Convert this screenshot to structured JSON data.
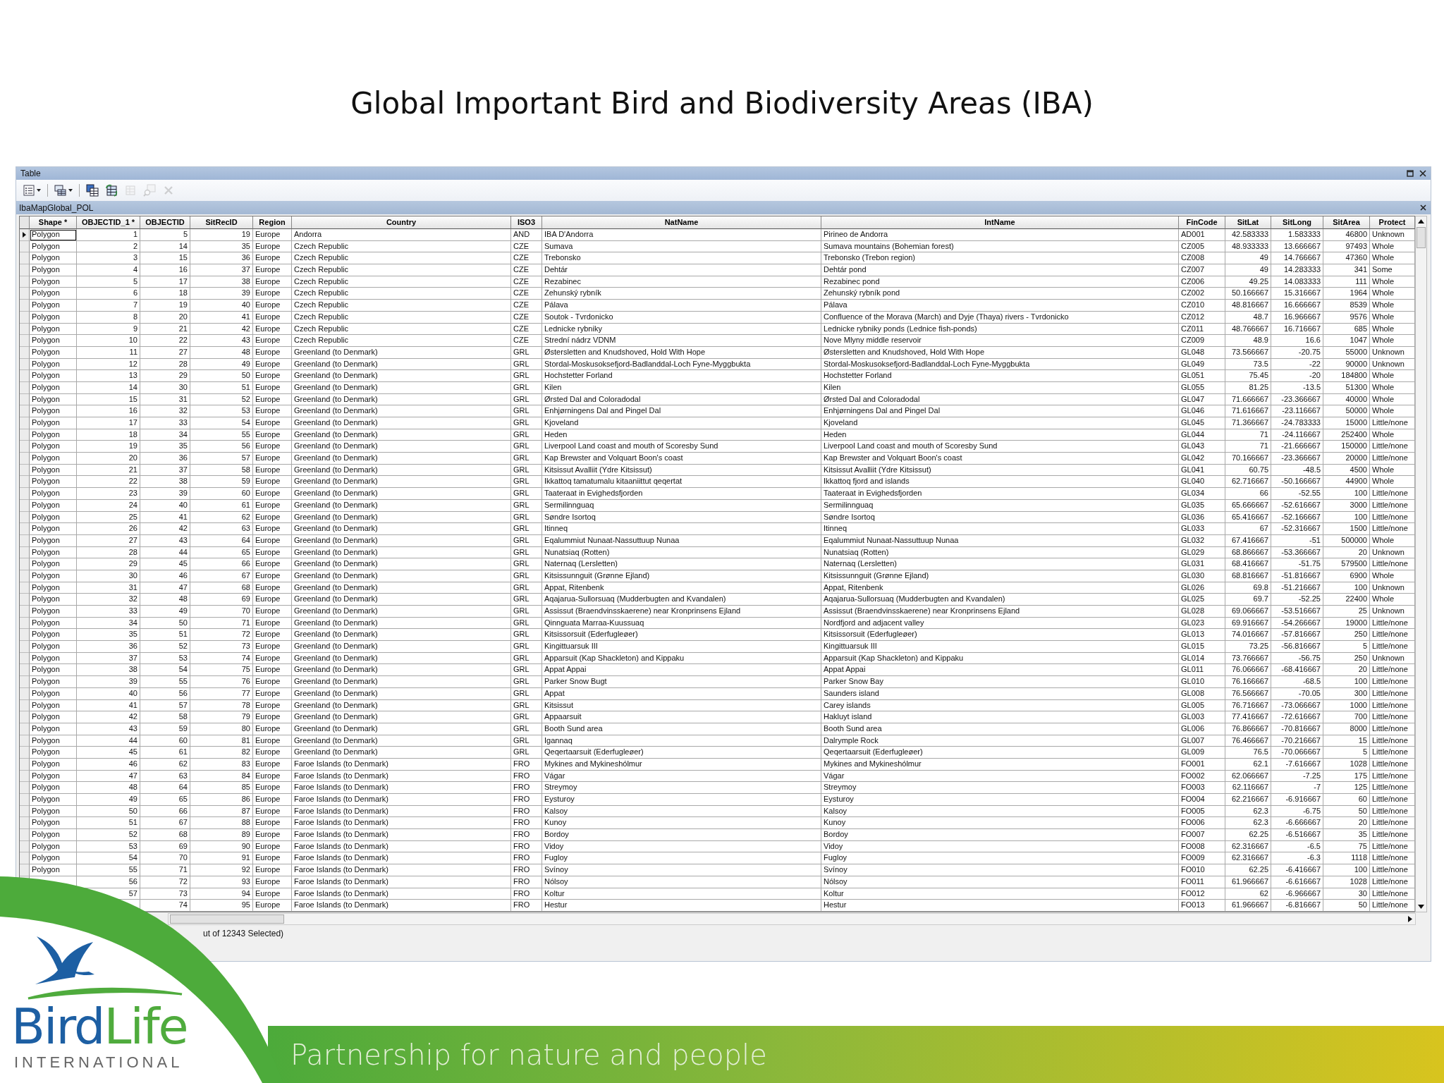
{
  "slide": {
    "title": "Global Important Bird and Biodiversity Areas (IBA)",
    "logo": {
      "parts": [
        {
          "text": "Bird",
          "color": "#1d5fa3"
        },
        {
          "text": "Life",
          "color": "#4fab3d"
        }
      ],
      "tagline": "INTERNATIONAL"
    },
    "slogan": "Partnership for nature and people"
  },
  "window": {
    "title": "Table",
    "toolbar": [
      {
        "kind": "table-options",
        "dropdown": true,
        "disabled": false
      },
      {
        "kind": "related-tables",
        "dropdown": true,
        "disabled": false
      },
      {
        "kind": "select-by-attributes",
        "dropdown": false,
        "disabled": false
      },
      {
        "kind": "switch-selection",
        "dropdown": false,
        "disabled": false
      },
      {
        "kind": "clear-selection",
        "dropdown": false,
        "disabled": true
      },
      {
        "kind": "zoom-to-selected",
        "dropdown": false,
        "disabled": true
      },
      {
        "kind": "delete-selected",
        "dropdown": false,
        "disabled": true
      }
    ],
    "layer_tab": "IbaMapGlobal_POL",
    "table": {
      "columns": [
        {
          "label": "Shape *",
          "kind": "text"
        },
        {
          "label": "OBJECTID_1 *",
          "kind": "number"
        },
        {
          "label": "OBJECTID",
          "kind": "number"
        },
        {
          "label": "SitRecID",
          "kind": "number"
        },
        {
          "label": "Region",
          "kind": "text"
        },
        {
          "label": "Country",
          "kind": "text"
        },
        {
          "label": "ISO3",
          "kind": "text"
        },
        {
          "label": "NatName",
          "kind": "text"
        },
        {
          "label": "IntName",
          "kind": "text"
        },
        {
          "label": "FinCode",
          "kind": "text"
        },
        {
          "label": "SitLat",
          "kind": "number"
        },
        {
          "label": "SitLong",
          "kind": "number"
        },
        {
          "label": "SitArea",
          "kind": "number"
        },
        {
          "label": "Protect",
          "kind": "text"
        }
      ],
      "rows": [
        {
          "current": true,
          "cells": [
            "Polygon",
            "1",
            "5",
            "19",
            "Europe",
            "Andorra",
            "AND",
            "IBA D'Andorra",
            "Pirineo de Andorra",
            "AD001",
            "42.583333",
            "1.583333",
            "46800",
            "Unknown"
          ]
        },
        {
          "current": false,
          "cells": [
            "Polygon",
            "2",
            "14",
            "35",
            "Europe",
            "Czech Republic",
            "CZE",
            "Sumava",
            "Sumava mountains (Bohemian forest)",
            "CZ005",
            "48.933333",
            "13.666667",
            "97493",
            "Whole"
          ]
        },
        {
          "current": false,
          "cells": [
            "Polygon",
            "3",
            "15",
            "36",
            "Europe",
            "Czech Republic",
            "CZE",
            "Trebonsko",
            "Trebonsko (Trebon region)",
            "CZ008",
            "49",
            "14.766667",
            "47360",
            "Whole"
          ]
        },
        {
          "current": false,
          "cells": [
            "Polygon",
            "4",
            "16",
            "37",
            "Europe",
            "Czech Republic",
            "CZE",
            "Dehtár",
            "Dehtár pond",
            "CZ007",
            "49",
            "14.283333",
            "341",
            "Some"
          ]
        },
        {
          "current": false,
          "cells": [
            "Polygon",
            "5",
            "17",
            "38",
            "Europe",
            "Czech Republic",
            "CZE",
            "Rezabinec",
            "Rezabinec pond",
            "CZ006",
            "49.25",
            "14.083333",
            "111",
            "Whole"
          ]
        },
        {
          "current": false,
          "cells": [
            "Polygon",
            "6",
            "18",
            "39",
            "Europe",
            "Czech Republic",
            "CZE",
            "Zehunský rybník",
            "Zehunský rybník pond",
            "CZ002",
            "50.166667",
            "15.316667",
            "1964",
            "Whole"
          ]
        },
        {
          "current": false,
          "cells": [
            "Polygon",
            "7",
            "19",
            "40",
            "Europe",
            "Czech Republic",
            "CZE",
            "Pálava",
            "Pálava",
            "CZ010",
            "48.816667",
            "16.666667",
            "8539",
            "Whole"
          ]
        },
        {
          "current": false,
          "cells": [
            "Polygon",
            "8",
            "20",
            "41",
            "Europe",
            "Czech Republic",
            "CZE",
            "Soutok - Tvrdonicko",
            "Confluence of the Morava (March) and Dyje (Thaya) rivers - Tvrdonicko",
            "CZ012",
            "48.7",
            "16.966667",
            "9576",
            "Whole"
          ]
        },
        {
          "current": false,
          "cells": [
            "Polygon",
            "9",
            "21",
            "42",
            "Europe",
            "Czech Republic",
            "CZE",
            "Lednicke rybniky",
            "Lednicke rybniky ponds (Lednice fish-ponds)",
            "CZ011",
            "48.766667",
            "16.716667",
            "685",
            "Whole"
          ]
        },
        {
          "current": false,
          "cells": [
            "Polygon",
            "10",
            "22",
            "43",
            "Europe",
            "Czech Republic",
            "CZE",
            "Strední nádrz VDNM",
            "Nove Mlyny middle reservoir",
            "CZ009",
            "48.9",
            "16.6",
            "1047",
            "Whole"
          ]
        },
        {
          "current": false,
          "cells": [
            "Polygon",
            "11",
            "27",
            "48",
            "Europe",
            "Greenland (to Denmark)",
            "GRL",
            "Østersletten and Knudshoved, Hold With Hope",
            "Østersletten and Knudshoved, Hold With Hope",
            "GL048",
            "73.566667",
            "-20.75",
            "55000",
            "Unknown"
          ]
        },
        {
          "current": false,
          "cells": [
            "Polygon",
            "12",
            "28",
            "49",
            "Europe",
            "Greenland (to Denmark)",
            "GRL",
            "Stordal-Moskusoksefjord-Badlanddal-Loch Fyne-Myggbukta",
            "Stordal-Moskusoksefjord-Badlanddal-Loch Fyne-Myggbukta",
            "GL049",
            "73.5",
            "-22",
            "90000",
            "Unknown"
          ]
        },
        {
          "current": false,
          "cells": [
            "Polygon",
            "13",
            "29",
            "50",
            "Europe",
            "Greenland (to Denmark)",
            "GRL",
            "Hochstetter Forland",
            "Hochstetter Forland",
            "GL051",
            "75.45",
            "-20",
            "184800",
            "Whole"
          ]
        },
        {
          "current": false,
          "cells": [
            "Polygon",
            "14",
            "30",
            "51",
            "Europe",
            "Greenland (to Denmark)",
            "GRL",
            "Kilen",
            "Kilen",
            "GL055",
            "81.25",
            "-13.5",
            "51300",
            "Whole"
          ]
        },
        {
          "current": false,
          "cells": [
            "Polygon",
            "15",
            "31",
            "52",
            "Europe",
            "Greenland (to Denmark)",
            "GRL",
            "Ørsted Dal and Coloradodal",
            "Ørsted Dal and Coloradodal",
            "GL047",
            "71.666667",
            "-23.366667",
            "40000",
            "Whole"
          ]
        },
        {
          "current": false,
          "cells": [
            "Polygon",
            "16",
            "32",
            "53",
            "Europe",
            "Greenland (to Denmark)",
            "GRL",
            "Enhjørningens Dal and Pingel Dal",
            "Enhjørningens Dal and Pingel Dal",
            "GL046",
            "71.616667",
            "-23.116667",
            "50000",
            "Whole"
          ]
        },
        {
          "current": false,
          "cells": [
            "Polygon",
            "17",
            "33",
            "54",
            "Europe",
            "Greenland (to Denmark)",
            "GRL",
            "Kjoveland",
            "Kjoveland",
            "GL045",
            "71.366667",
            "-24.783333",
            "15000",
            "Little/none"
          ]
        },
        {
          "current": false,
          "cells": [
            "Polygon",
            "18",
            "34",
            "55",
            "Europe",
            "Greenland (to Denmark)",
            "GRL",
            "Heden",
            "Heden",
            "GL044",
            "71",
            "-24.116667",
            "252400",
            "Whole"
          ]
        },
        {
          "current": false,
          "cells": [
            "Polygon",
            "19",
            "35",
            "56",
            "Europe",
            "Greenland (to Denmark)",
            "GRL",
            "Liverpool Land coast and mouth of Scoresby Sund",
            "Liverpool Land coast and mouth of Scoresby Sund",
            "GL043",
            "71",
            "-21.666667",
            "150000",
            "Little/none"
          ]
        },
        {
          "current": false,
          "cells": [
            "Polygon",
            "20",
            "36",
            "57",
            "Europe",
            "Greenland (to Denmark)",
            "GRL",
            "Kap Brewster and Volquart Boon's coast",
            "Kap Brewster and Volquart Boon's coast",
            "GL042",
            "70.166667",
            "-23.366667",
            "20000",
            "Little/none"
          ]
        },
        {
          "current": false,
          "cells": [
            "Polygon",
            "21",
            "37",
            "58",
            "Europe",
            "Greenland (to Denmark)",
            "GRL",
            "Kitsissut Avalliit (Ydre Kitsissut)",
            "Kitsissut Avalliit (Ydre Kitsissut)",
            "GL041",
            "60.75",
            "-48.5",
            "4500",
            "Whole"
          ]
        },
        {
          "current": false,
          "cells": [
            "Polygon",
            "22",
            "38",
            "59",
            "Europe",
            "Greenland (to Denmark)",
            "GRL",
            "Ikkattoq tamatumalu kitaaniittut qeqertat",
            "Ikkattoq fjord and islands",
            "GL040",
            "62.716667",
            "-50.166667",
            "44900",
            "Whole"
          ]
        },
        {
          "current": false,
          "cells": [
            "Polygon",
            "23",
            "39",
            "60",
            "Europe",
            "Greenland (to Denmark)",
            "GRL",
            "Taateraat in Evighedsfjorden",
            "Taateraat in Evighedsfjorden",
            "GL034",
            "66",
            "-52.55",
            "100",
            "Little/none"
          ]
        },
        {
          "current": false,
          "cells": [
            "Polygon",
            "24",
            "40",
            "61",
            "Europe",
            "Greenland (to Denmark)",
            "GRL",
            "Sermilinnguaq",
            "Sermilinnguaq",
            "GL035",
            "65.666667",
            "-52.616667",
            "3000",
            "Little/none"
          ]
        },
        {
          "current": false,
          "cells": [
            "Polygon",
            "25",
            "41",
            "62",
            "Europe",
            "Greenland (to Denmark)",
            "GRL",
            "Søndre Isortoq",
            "Søndre Isortoq",
            "GL036",
            "65.416667",
            "-52.166667",
            "100",
            "Little/none"
          ]
        },
        {
          "current": false,
          "cells": [
            "Polygon",
            "26",
            "42",
            "63",
            "Europe",
            "Greenland (to Denmark)",
            "GRL",
            "Itinneq",
            "Itinneq",
            "GL033",
            "67",
            "-52.316667",
            "1500",
            "Little/none"
          ]
        },
        {
          "current": false,
          "cells": [
            "Polygon",
            "27",
            "43",
            "64",
            "Europe",
            "Greenland (to Denmark)",
            "GRL",
            "Eqalummiut Nunaat-Nassuttuup Nunaa",
            "Eqalummiut Nunaat-Nassuttuup Nunaa",
            "GL032",
            "67.416667",
            "-51",
            "500000",
            "Whole"
          ]
        },
        {
          "current": false,
          "cells": [
            "Polygon",
            "28",
            "44",
            "65",
            "Europe",
            "Greenland (to Denmark)",
            "GRL",
            "Nunatsiaq (Rotten)",
            "Nunatsiaq (Rotten)",
            "GL029",
            "68.866667",
            "-53.366667",
            "20",
            "Unknown"
          ]
        },
        {
          "current": false,
          "cells": [
            "Polygon",
            "29",
            "45",
            "66",
            "Europe",
            "Greenland (to Denmark)",
            "GRL",
            "Naternaq (Lersletten)",
            "Naternaq (Lersletten)",
            "GL031",
            "68.416667",
            "-51.75",
            "579500",
            "Little/none"
          ]
        },
        {
          "current": false,
          "cells": [
            "Polygon",
            "30",
            "46",
            "67",
            "Europe",
            "Greenland (to Denmark)",
            "GRL",
            "Kitsissunnguit (Grønne Ejland)",
            "Kitsissunnguit (Grønne Ejland)",
            "GL030",
            "68.816667",
            "-51.816667",
            "6900",
            "Whole"
          ]
        },
        {
          "current": false,
          "cells": [
            "Polygon",
            "31",
            "47",
            "68",
            "Europe",
            "Greenland (to Denmark)",
            "GRL",
            "Appat, Ritenbenk",
            "Appat, Ritenbenk",
            "GL026",
            "69.8",
            "-51.216667",
            "100",
            "Unknown"
          ]
        },
        {
          "current": false,
          "cells": [
            "Polygon",
            "32",
            "48",
            "69",
            "Europe",
            "Greenland (to Denmark)",
            "GRL",
            "Aqajarua-Sullorsuaq (Mudderbugten and Kvandalen)",
            "Aqajarua-Sullorsuaq (Mudderbugten and Kvandalen)",
            "GL025",
            "69.7",
            "-52.25",
            "22400",
            "Whole"
          ]
        },
        {
          "current": false,
          "cells": [
            "Polygon",
            "33",
            "49",
            "70",
            "Europe",
            "Greenland (to Denmark)",
            "GRL",
            "Assissut (Braendvinsskaerene) near Kronprinsens Ejland",
            "Assissut (Braendvinsskaerene) near Kronprinsens Ejland",
            "GL028",
            "69.066667",
            "-53.516667",
            "25",
            "Unknown"
          ]
        },
        {
          "current": false,
          "cells": [
            "Polygon",
            "34",
            "50",
            "71",
            "Europe",
            "Greenland (to Denmark)",
            "GRL",
            "Qinnguata Marraa-Kuussuaq",
            "Nordfjord and adjacent valley",
            "GL023",
            "69.916667",
            "-54.266667",
            "19000",
            "Little/none"
          ]
        },
        {
          "current": false,
          "cells": [
            "Polygon",
            "35",
            "51",
            "72",
            "Europe",
            "Greenland (to Denmark)",
            "GRL",
            "Kitsissorsuit (Ederfugleøer)",
            "Kitsissorsuit (Ederfugleøer)",
            "GL013",
            "74.016667",
            "-57.816667",
            "250",
            "Little/none"
          ]
        },
        {
          "current": false,
          "cells": [
            "Polygon",
            "36",
            "52",
            "73",
            "Europe",
            "Greenland (to Denmark)",
            "GRL",
            "Kingittuarsuk III",
            "Kingittuarsuk III",
            "GL015",
            "73.25",
            "-56.816667",
            "5",
            "Little/none"
          ]
        },
        {
          "current": false,
          "cells": [
            "Polygon",
            "37",
            "53",
            "74",
            "Europe",
            "Greenland (to Denmark)",
            "GRL",
            "Apparsuit (Kap Shackleton) and Kippaku",
            "Apparsuit (Kap Shackleton) and Kippaku",
            "GL014",
            "73.766667",
            "-56.75",
            "250",
            "Unknown"
          ]
        },
        {
          "current": false,
          "cells": [
            "Polygon",
            "38",
            "54",
            "75",
            "Europe",
            "Greenland (to Denmark)",
            "GRL",
            "Appat Appai",
            "Appat Appai",
            "GL011",
            "76.066667",
            "-68.416667",
            "20",
            "Little/none"
          ]
        },
        {
          "current": false,
          "cells": [
            "Polygon",
            "39",
            "55",
            "76",
            "Europe",
            "Greenland (to Denmark)",
            "GRL",
            "Parker Snow Bugt",
            "Parker Snow Bay",
            "GL010",
            "76.166667",
            "-68.5",
            "100",
            "Little/none"
          ]
        },
        {
          "current": false,
          "cells": [
            "Polygon",
            "40",
            "56",
            "77",
            "Europe",
            "Greenland (to Denmark)",
            "GRL",
            "Appat",
            "Saunders island",
            "GL008",
            "76.566667",
            "-70.05",
            "300",
            "Little/none"
          ]
        },
        {
          "current": false,
          "cells": [
            "Polygon",
            "41",
            "57",
            "78",
            "Europe",
            "Greenland (to Denmark)",
            "GRL",
            "Kitsissut",
            "Carey islands",
            "GL005",
            "76.716667",
            "-73.066667",
            "1000",
            "Little/none"
          ]
        },
        {
          "current": false,
          "cells": [
            "Polygon",
            "42",
            "58",
            "79",
            "Europe",
            "Greenland (to Denmark)",
            "GRL",
            "Appaarsuit",
            "Hakluyt island",
            "GL003",
            "77.416667",
            "-72.616667",
            "700",
            "Little/none"
          ]
        },
        {
          "current": false,
          "cells": [
            "Polygon",
            "43",
            "59",
            "80",
            "Europe",
            "Greenland (to Denmark)",
            "GRL",
            "Booth Sund area",
            "Booth Sund area",
            "GL006",
            "76.866667",
            "-70.816667",
            "8000",
            "Little/none"
          ]
        },
        {
          "current": false,
          "cells": [
            "Polygon",
            "44",
            "60",
            "81",
            "Europe",
            "Greenland (to Denmark)",
            "GRL",
            "Igannaq",
            "Dalrymple Rock",
            "GL007",
            "76.466667",
            "-70.216667",
            "15",
            "Little/none"
          ]
        },
        {
          "current": false,
          "cells": [
            "Polygon",
            "45",
            "61",
            "82",
            "Europe",
            "Greenland (to Denmark)",
            "GRL",
            "Qeqertaarsuit (Ederfugleøer)",
            "Qeqertaarsuit (Ederfugleøer)",
            "GL009",
            "76.5",
            "-70.066667",
            "5",
            "Little/none"
          ]
        },
        {
          "current": false,
          "cells": [
            "Polygon",
            "46",
            "62",
            "83",
            "Europe",
            "Faroe Islands (to Denmark)",
            "FRO",
            "Mykines and Mykineshólmur",
            "Mykines and Mykineshólmur",
            "FO001",
            "62.1",
            "-7.616667",
            "1028",
            "Little/none"
          ]
        },
        {
          "current": false,
          "cells": [
            "Polygon",
            "47",
            "63",
            "84",
            "Europe",
            "Faroe Islands (to Denmark)",
            "FRO",
            "Vágar",
            "Vágar",
            "FO002",
            "62.066667",
            "-7.25",
            "175",
            "Little/none"
          ]
        },
        {
          "current": false,
          "cells": [
            "Polygon",
            "48",
            "64",
            "85",
            "Europe",
            "Faroe Islands (to Denmark)",
            "FRO",
            "Streymoy",
            "Streymoy",
            "FO003",
            "62.116667",
            "-7",
            "125",
            "Little/none"
          ]
        },
        {
          "current": false,
          "cells": [
            "Polygon",
            "49",
            "65",
            "86",
            "Europe",
            "Faroe Islands (to Denmark)",
            "FRO",
            "Eysturoy",
            "Eysturoy",
            "FO004",
            "62.216667",
            "-6.916667",
            "60",
            "Little/none"
          ]
        },
        {
          "current": false,
          "cells": [
            "Polygon",
            "50",
            "66",
            "87",
            "Europe",
            "Faroe Islands (to Denmark)",
            "FRO",
            "Kalsoy",
            "Kalsoy",
            "FO005",
            "62.3",
            "-6.75",
            "50",
            "Little/none"
          ]
        },
        {
          "current": false,
          "cells": [
            "Polygon",
            "51",
            "67",
            "88",
            "Europe",
            "Faroe Islands (to Denmark)",
            "FRO",
            "Kunoy",
            "Kunoy",
            "FO006",
            "62.3",
            "-6.666667",
            "20",
            "Little/none"
          ]
        },
        {
          "current": false,
          "cells": [
            "Polygon",
            "52",
            "68",
            "89",
            "Europe",
            "Faroe Islands (to Denmark)",
            "FRO",
            "Bordoy",
            "Bordoy",
            "FO007",
            "62.25",
            "-6.516667",
            "35",
            "Little/none"
          ]
        },
        {
          "current": false,
          "cells": [
            "Polygon",
            "53",
            "69",
            "90",
            "Europe",
            "Faroe Islands (to Denmark)",
            "FRO",
            "Vidoy",
            "Vidoy",
            "FO008",
            "62.316667",
            "-6.5",
            "75",
            "Little/none"
          ]
        },
        {
          "current": false,
          "cells": [
            "Polygon",
            "54",
            "70",
            "91",
            "Europe",
            "Faroe Islands (to Denmark)",
            "FRO",
            "Fugloy",
            "Fugloy",
            "FO009",
            "62.316667",
            "-6.3",
            "1118",
            "Little/none"
          ]
        },
        {
          "current": false,
          "cells": [
            "Polygon",
            "55",
            "71",
            "92",
            "Europe",
            "Faroe Islands (to Denmark)",
            "FRO",
            "Svínoy",
            "Svínoy",
            "FO010",
            "62.25",
            "-6.416667",
            "100",
            "Little/none"
          ]
        },
        {
          "cells": [
            null,
            "56",
            "72",
            "93",
            "Europe",
            "Faroe Islands (to Denmark)",
            "FRO",
            "Nólsoy",
            "Nólsoy",
            "FO011",
            "61.966667",
            "-6.616667",
            "1028",
            "Little/none"
          ]
        },
        {
          "cells": [
            null,
            "57",
            "73",
            "94",
            "Europe",
            "Faroe Islands (to Denmark)",
            "FRO",
            "Koltur",
            "Koltur",
            "FO012",
            "62",
            "-6.966667",
            "30",
            "Little/none"
          ]
        },
        {
          "cells": [
            null,
            null,
            "74",
            "95",
            "Europe",
            "Faroe Islands (to Denmark)",
            "FRO",
            "Hestur",
            "Hestur",
            "FO013",
            "61.966667",
            "-6.816667",
            "50",
            "Little/none"
          ]
        }
      ]
    },
    "status_bar": "ut of 12343 Selected)"
  }
}
